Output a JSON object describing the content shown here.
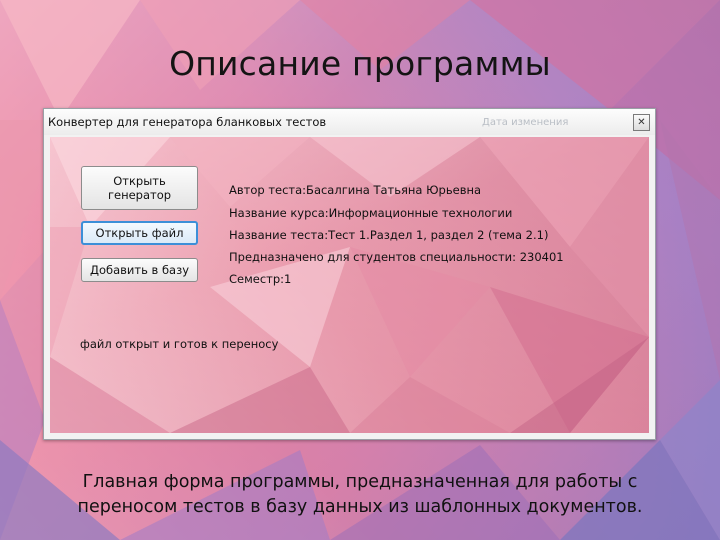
{
  "slide": {
    "title": "Описание программы",
    "caption_line1": "Главная форма программы, предназначенная для работы с",
    "caption_line2": "переносом тестов в базу данных из шаблонных документов."
  },
  "window": {
    "title": "Конвертер для генератора бланковых тестов",
    "ghost_text": "Дата изменения",
    "close_glyph": "✕"
  },
  "buttons": {
    "open_generator": "Открыть генератор",
    "open_file": "Открыть файл",
    "add_to_db": "Добавить в базу"
  },
  "info": {
    "author": "Автор теста:Басалгина Татьяна Юрьевна",
    "course": "Название курса:Информационные технологии",
    "test_name": "Название теста:Тест 1.Раздел 1, раздел 2 (тема 2.1)",
    "specialty": "Предназначено для студентов специальности: 230401",
    "semester": "Семестр:1"
  },
  "status": "файл открыт и готов к переносу"
}
